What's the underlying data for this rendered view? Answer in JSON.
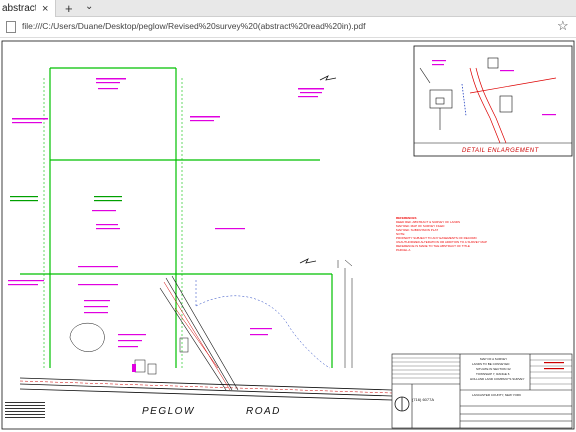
{
  "browser": {
    "tab_title": "abstract",
    "tab_close": "×",
    "new_tab": "+",
    "tab_menu": "⌄",
    "url": "file:///C:/Users/Duane/Desktop/peglow/Revised%20survey%20(abstract%20read%20in).pdf",
    "bookmark_icon": "star-icon"
  },
  "drawing": {
    "detail_title": "DETAIL ENLARGEMENT",
    "road_label_1": "PEGLOW",
    "road_label_2": "ROAD",
    "notes_heading": "REFERENCES",
    "notes_lines": [
      "DEED REF. ABSTRACT & SURVEY OF LANDS",
      "MAP REF. MAP OF SURVEY FILED",
      "MAP REF. SUBDIVISION PLAT",
      "NOTE:",
      "PROPERTY SUBJECT TO ANY EASEMENTS OF RECORD",
      "UNAUTHORIZED ALTERATION OR ADDITION TO A SURVEY MAP",
      "REFERENCE IS MADE TO THE ABSTRACT OF TITLE",
      "PARCEL A"
    ],
    "firm_phone": "(716) 6077A",
    "title_block_lines": [
      "MAP OF A SURVEY",
      "LANDS TO BE CONVEYED",
      "SITUATE IN SECTION 32",
      "TOWNSHIP 7, RANGE 6",
      "HOLLAND LAND COMPANY'S SURVEY",
      "LANCASTER COUNTY, NEW YORK"
    ]
  },
  "colors": {
    "property_line": "#00c000",
    "annotation": "#e000e0",
    "detail_red": "#d00000",
    "linework": "#111111",
    "blue": "#2040c0"
  }
}
